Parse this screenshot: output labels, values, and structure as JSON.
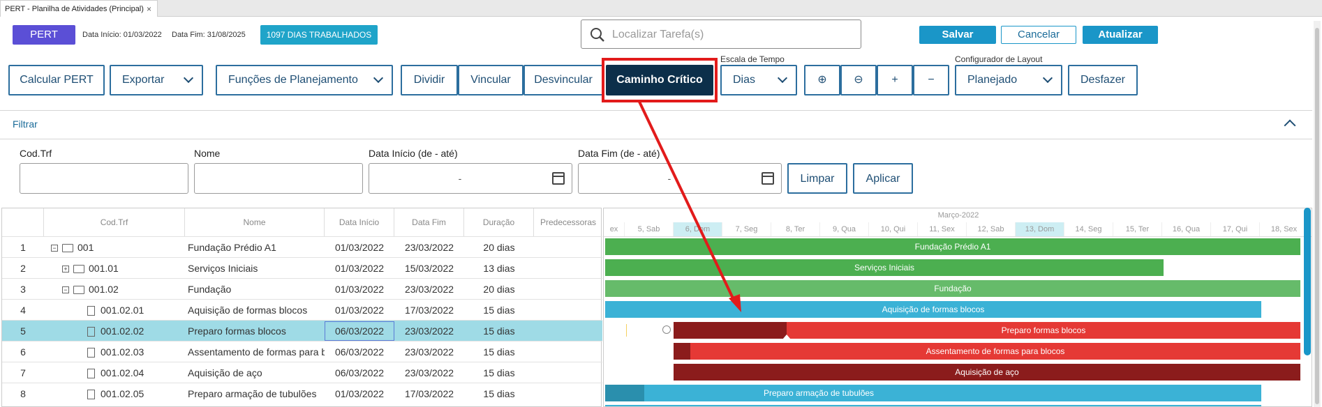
{
  "tab": {
    "title": "PERT - Planilha de Atividades (Principal)",
    "close": "×"
  },
  "header": {
    "pert_label": "PERT",
    "data_inicio": "Data Início: 01/03/2022",
    "data_fim": "Data Fim: 31/08/2025",
    "badge": "1097 DIAS TRABALHADOS",
    "search_placeholder": "Localizar Tarefa(s)",
    "salvar": "Salvar",
    "cancelar": "Cancelar",
    "atualizar": "Atualizar"
  },
  "toolbar": {
    "calcular": "Calcular PERT",
    "exportar": "Exportar",
    "funcoes": "Funções de Planejamento",
    "dividir": "Dividir",
    "vincular": "Vincular",
    "desvincular": "Desvincular",
    "caminho": "Caminho Crítico",
    "escala_label": "Escala de Tempo",
    "escala": "Dias",
    "zoom_in": "⊕",
    "zoom_out": "⊖",
    "plus": "+",
    "minus": "−",
    "config_label": "Configurador de Layout",
    "layout": "Planejado",
    "desfazer": "Desfazer"
  },
  "filter": {
    "title": "Filtrar",
    "cod_label": "Cod.Trf",
    "nome_label": "Nome",
    "di_label": "Data Início (de - até)",
    "df_label": "Data Fim (de - até)",
    "dash": "-",
    "limpar": "Limpar",
    "aplicar": "Aplicar"
  },
  "grid": {
    "columns": [
      "Cod.Trf",
      "Nome",
      "Data Início",
      "Data Fim",
      "Duração",
      "Predecessoras"
    ],
    "rows": [
      {
        "n": "1",
        "cod": "001",
        "nome": "Fundação Prédio A1",
        "di": "01/03/2022",
        "df": "23/03/2022",
        "dur": "20 dias"
      },
      {
        "n": "2",
        "cod": "001.01",
        "nome": "Serviços Iniciais",
        "di": "01/03/2022",
        "df": "15/03/2022",
        "dur": "13 dias"
      },
      {
        "n": "3",
        "cod": "001.02",
        "nome": "Fundação",
        "di": "01/03/2022",
        "df": "23/03/2022",
        "dur": "20 dias"
      },
      {
        "n": "4",
        "cod": "001.02.01",
        "nome": "Aquisição de formas blocos",
        "di": "01/03/2022",
        "df": "17/03/2022",
        "dur": "15 dias"
      },
      {
        "n": "5",
        "cod": "001.02.02",
        "nome": "Preparo formas blocos",
        "di": "06/03/2022",
        "df": "23/03/2022",
        "dur": "15 dias"
      },
      {
        "n": "6",
        "cod": "001.02.03",
        "nome": "Assentamento de formas para blc",
        "di": "06/03/2022",
        "df": "23/03/2022",
        "dur": "15 dias"
      },
      {
        "n": "7",
        "cod": "001.02.04",
        "nome": "Aquisição de aço",
        "di": "06/03/2022",
        "df": "23/03/2022",
        "dur": "15 dias"
      },
      {
        "n": "8",
        "cod": "001.02.05",
        "nome": "Preparo armação de tubulões",
        "di": "01/03/2022",
        "df": "17/03/2022",
        "dur": "15 dias"
      }
    ]
  },
  "gantt": {
    "month": "Março-2022",
    "days": [
      "ex",
      "5, Sab",
      "6, Dom",
      "7, Seg",
      "8, Ter",
      "9, Qua",
      "10, Qui",
      "11, Sex",
      "12, Sab",
      "13, Dom",
      "14, Seg",
      "15, Ter",
      "16, Qua",
      "17, Qui",
      "18, Sex"
    ],
    "bars": [
      "Fundação Prédio A1",
      "Serviços Iniciais",
      "Fundação",
      "Aquisição de formas blocos",
      "Preparo formas blocos",
      "Assentamento de formas para blocos",
      "Aquisição de aço",
      "Preparo armação de tubulões"
    ],
    "colors": {
      "green_dark": "#4caf50",
      "green_light": "#66bb6a",
      "blue": "#3bb2d6",
      "red": "#e53935",
      "dark_red": "#8b1c1c"
    }
  }
}
